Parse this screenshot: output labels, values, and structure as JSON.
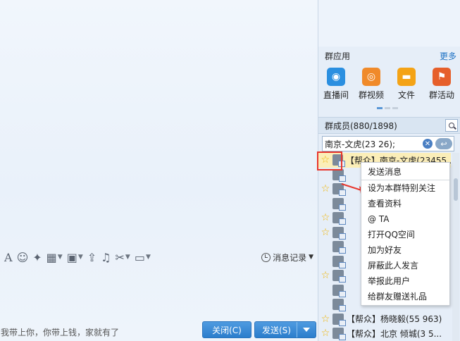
{
  "chat": {
    "input_text": "我带上你，你带上钱，家就有了",
    "message_log_label": "消息记录",
    "close_button": "关闭(C)",
    "send_button": "发送(S)"
  },
  "group_apps": {
    "title": "群应用",
    "more": "更多",
    "items": [
      {
        "label": "直播间",
        "icon": "live-room-icon",
        "color": "#2b8fe0"
      },
      {
        "label": "群视频",
        "icon": "group-video-icon",
        "color": "#f08a2a"
      },
      {
        "label": "文件",
        "icon": "folder-icon",
        "color": "#f4a316"
      },
      {
        "label": "群活动",
        "icon": "group-activity-icon",
        "color": "#e65f2b"
      }
    ]
  },
  "members": {
    "title": "群成员(880/1898)",
    "search_value": "南京-文虎(23      26);",
    "rows": [
      {
        "name": "【帮众】南京-文虎(23455...",
        "star": true,
        "selected": true
      },
      {
        "name": "",
        "star": false
      },
      {
        "name": "",
        "star": true
      },
      {
        "name": "",
        "star": false
      },
      {
        "name": "",
        "star": true
      },
      {
        "name": "",
        "star": true
      },
      {
        "name": "",
        "star": false
      },
      {
        "name": "",
        "star": false
      },
      {
        "name": "",
        "star": true
      },
      {
        "name": "",
        "star": false
      },
      {
        "name": "",
        "star": false
      },
      {
        "name": "【帮众】杨晓毅(55     963)",
        "star": true
      },
      {
        "name": "【帮众】北京 倾城(3      5...",
        "star": true
      }
    ]
  },
  "context_menu": {
    "items": [
      "发送消息",
      "设为本群特别关注",
      "查看资料",
      "@ TA",
      "打开QQ空间",
      "加为好友",
      "屏蔽此人发言",
      "举报此用户",
      "给群友赠送礼品"
    ]
  }
}
